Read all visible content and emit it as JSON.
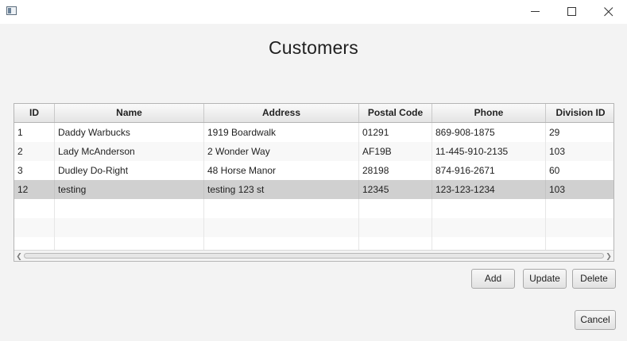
{
  "window": {
    "icon": "app-window-icon",
    "controls": [
      "minimize-icon",
      "maximize-icon",
      "close-icon"
    ]
  },
  "page": {
    "title": "Customers"
  },
  "table": {
    "columns": [
      "ID",
      "Name",
      "Address",
      "Postal Code",
      "Phone",
      "Division ID"
    ],
    "rows": [
      [
        "1",
        "Daddy Warbucks",
        "1919 Boardwalk",
        "01291",
        "869-908-1875",
        "29"
      ],
      [
        "2",
        "Lady McAnderson",
        "2 Wonder Way",
        "AF19B",
        "11-445-910-2135",
        "103"
      ],
      [
        "3",
        "Dudley Do-Right",
        "48 Horse Manor",
        "28198",
        "874-916-2671",
        "60"
      ],
      [
        "12",
        "testing",
        "testing 123 st",
        "12345",
        "123-123-1234",
        "103"
      ]
    ],
    "selected_row": 3,
    "empty_rows": 3
  },
  "buttons": {
    "add": "Add",
    "update": "Update",
    "delete": "Delete",
    "cancel": "Cancel"
  }
}
